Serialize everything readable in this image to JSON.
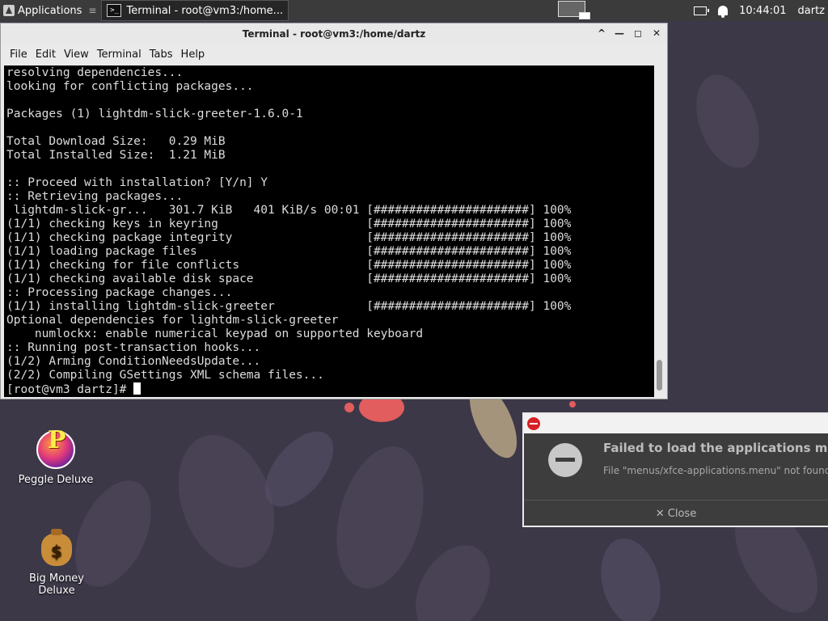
{
  "panel": {
    "applications_label": "Applications",
    "separator": "≡",
    "task_label": "Terminal - root@vm3:/home...",
    "clock": "10:44:01",
    "user": "dartz"
  },
  "terminal": {
    "title": "Terminal - root@vm3:/home/dartz",
    "controls": {
      "up": "^",
      "minimize": "—",
      "maximize": "◻",
      "close": "✕"
    },
    "menu": [
      "File",
      "Edit",
      "View",
      "Terminal",
      "Tabs",
      "Help"
    ],
    "lines": [
      "resolving dependencies...",
      "looking for conflicting packages...",
      "",
      "Packages (1) lightdm-slick-greeter-1.6.0-1",
      "",
      "Total Download Size:   0.29 MiB",
      "Total Installed Size:  1.21 MiB",
      "",
      ":: Proceed with installation? [Y/n] Y",
      ":: Retrieving packages...",
      " lightdm-slick-gr...   301.7 KiB   401 KiB/s 00:01 [######################] 100%",
      "(1/1) checking keys in keyring                     [######################] 100%",
      "(1/1) checking package integrity                   [######################] 100%",
      "(1/1) loading package files                        [######################] 100%",
      "(1/1) checking for file conflicts                  [######################] 100%",
      "(1/1) checking available disk space                [######################] 100%",
      ":: Processing package changes...",
      "(1/1) installing lightdm-slick-greeter             [######################] 100%",
      "Optional dependencies for lightdm-slick-greeter",
      "    numlockx: enable numerical keypad on supported keyboard",
      ":: Running post-transaction hooks...",
      "(1/2) Arming ConditionNeedsUpdate...",
      "(2/2) Compiling GSettings XML schema files..."
    ],
    "prompt": "[root@vm3 dartz]# "
  },
  "desktop": {
    "icons": [
      {
        "label": "Peggle Deluxe"
      },
      {
        "label": "Big Money Deluxe",
        "glyph": "$"
      }
    ]
  },
  "notification": {
    "title": "Failed to load the applications menu",
    "message": "File \"menus/xfce-applications.menu\" not found",
    "close_label": "✕ Close"
  }
}
